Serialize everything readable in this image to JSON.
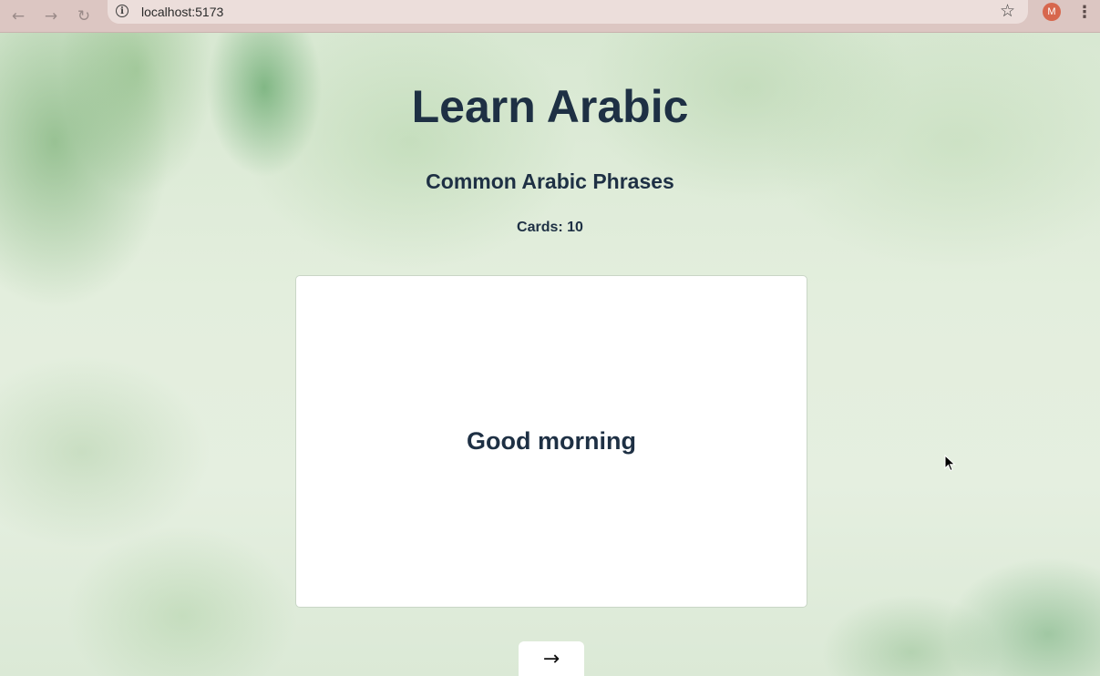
{
  "browser": {
    "back_icon": "←",
    "forward_icon": "→",
    "reload_icon": "↻",
    "url": "localhost:5173",
    "info_icon": "i",
    "star_icon": "☆",
    "avatar_letter": "M",
    "menu_icon": "⋮"
  },
  "page": {
    "title": "Learn Arabic",
    "deck_title": "Common Arabic Phrases",
    "card_count_label": "Cards: 10",
    "current_card": "Good morning",
    "next_icon": "→"
  },
  "colors": {
    "text_primary": "#1e3044",
    "avatar_bg": "#d7674d",
    "browser_chrome": "#dcc6c2"
  }
}
